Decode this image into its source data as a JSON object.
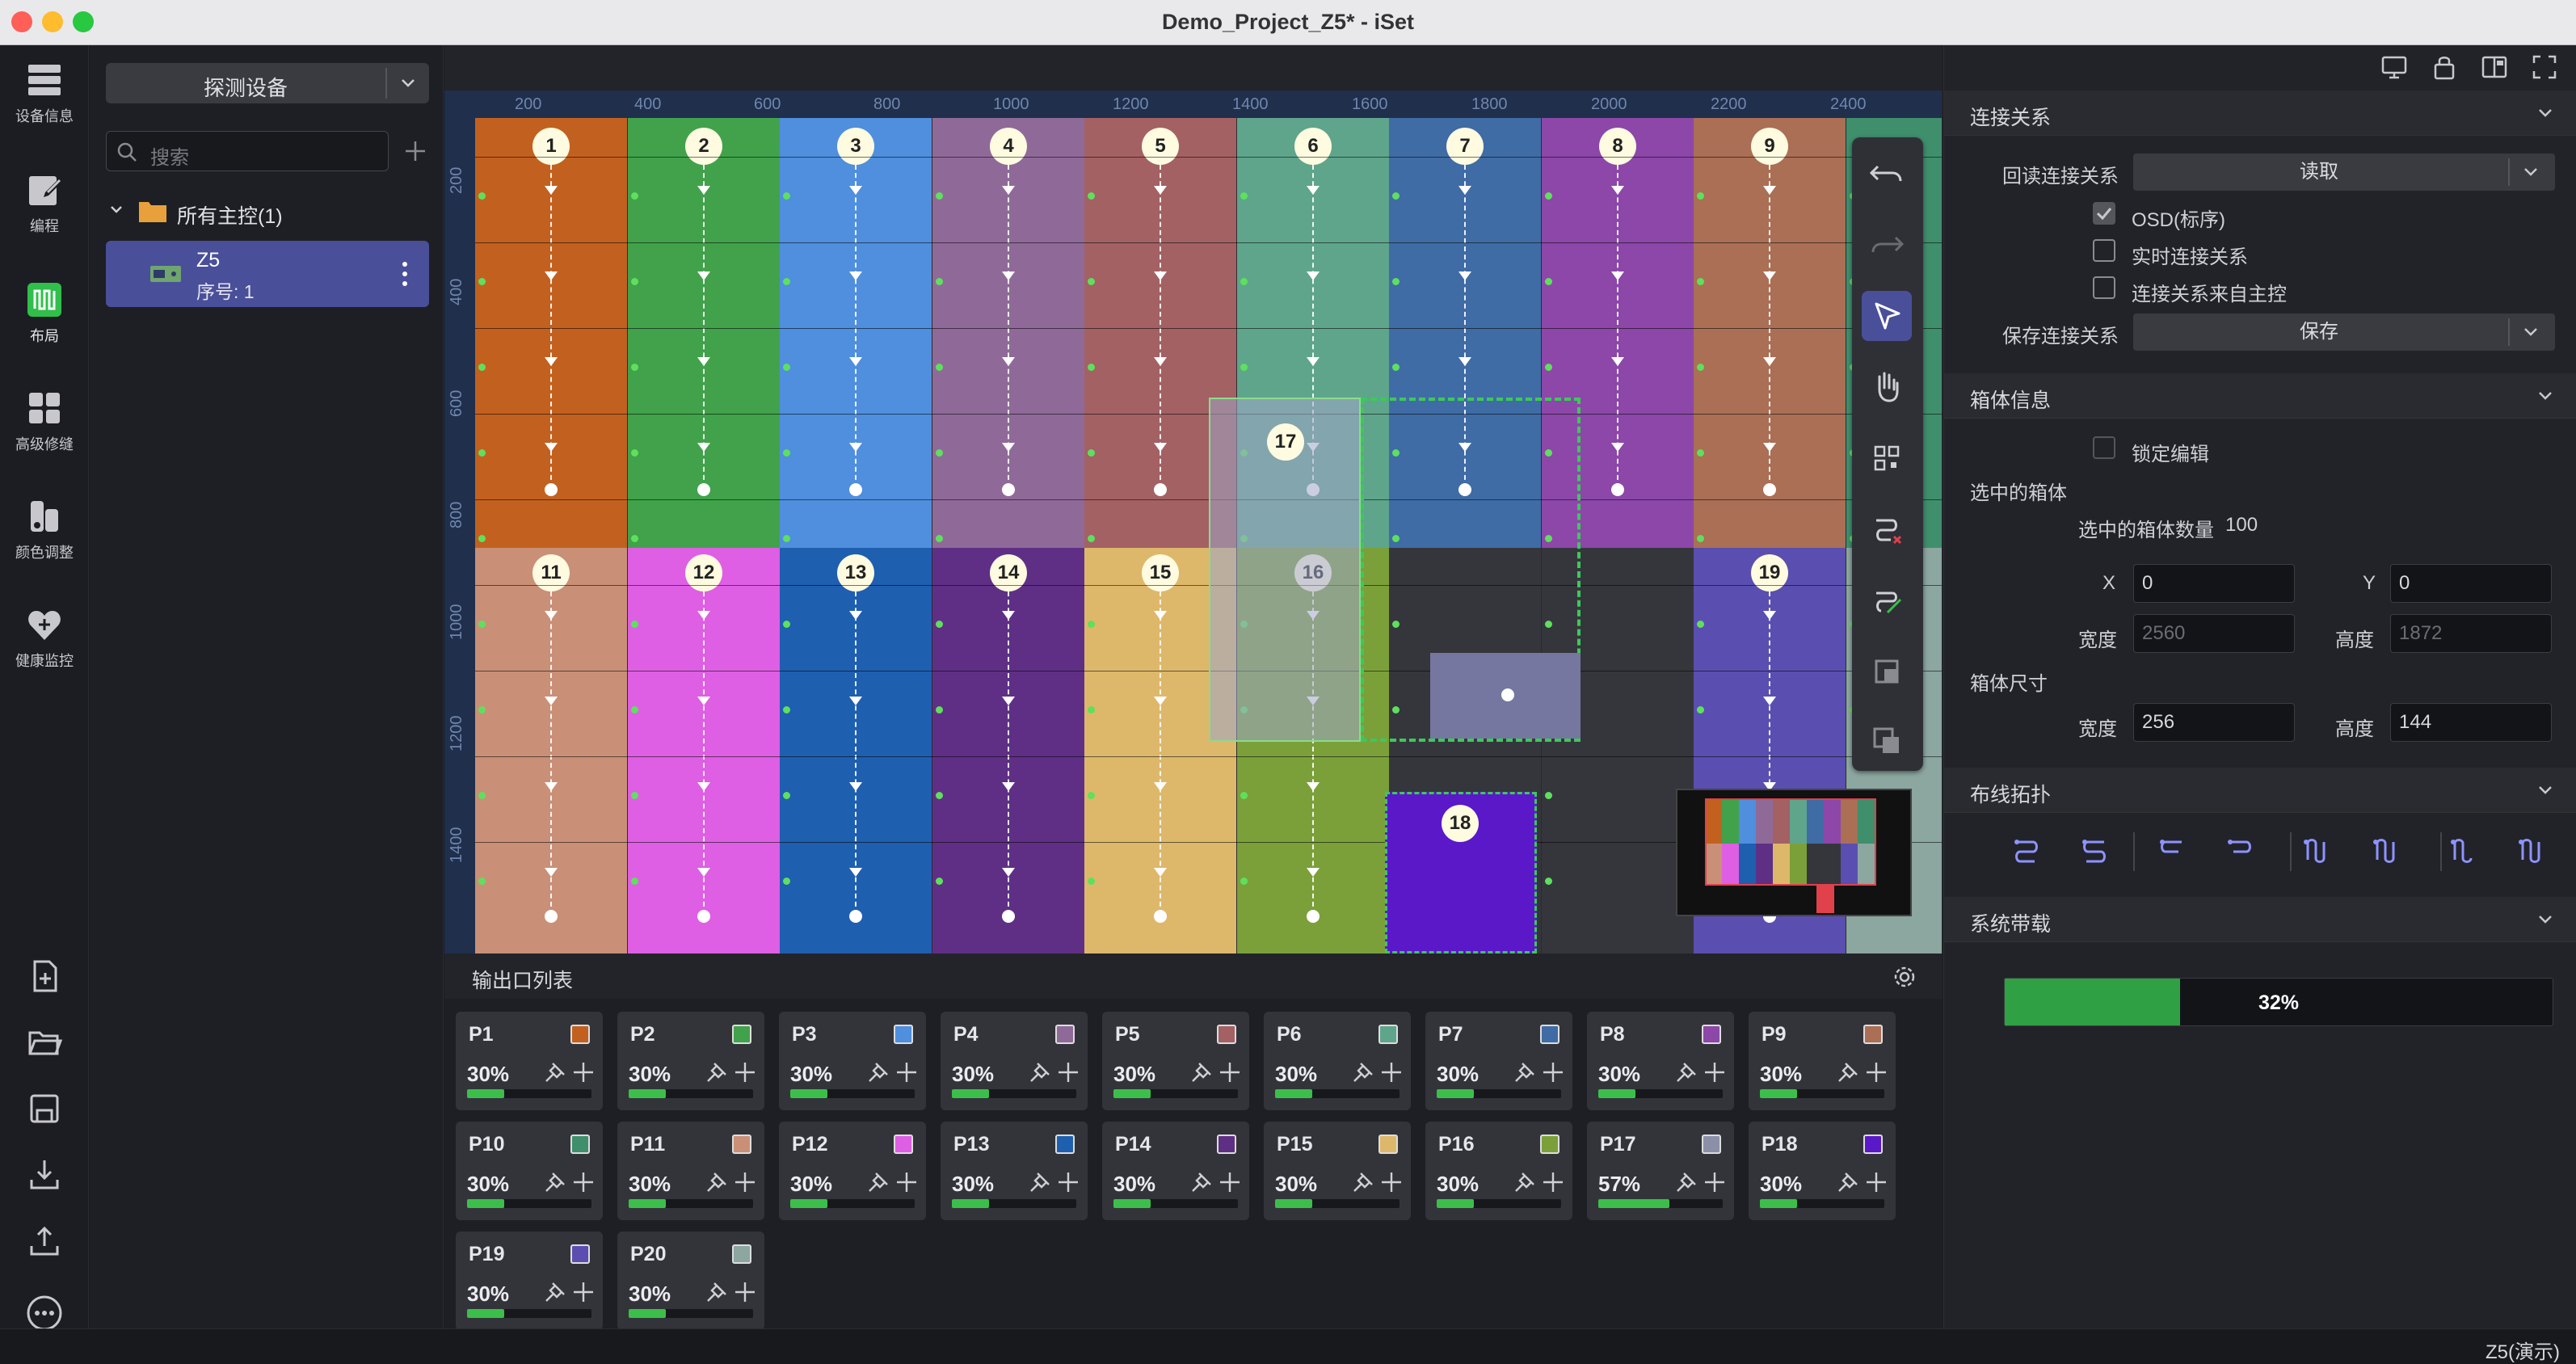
{
  "window": {
    "title": "Demo_Project_Z5* - iSet"
  },
  "nav": {
    "items": [
      {
        "label": "设备信息",
        "icon": "device-info-icon"
      },
      {
        "label": "编程",
        "icon": "edit-icon"
      },
      {
        "label": "布局",
        "icon": "layout-icon"
      },
      {
        "label": "高级修缝",
        "icon": "grid-icon"
      },
      {
        "label": "颜色调整",
        "icon": "color-adjust-icon"
      },
      {
        "label": "健康监控",
        "icon": "heart-icon"
      }
    ],
    "menu_label": "菜单"
  },
  "device_panel": {
    "probe_label": "探测设备",
    "search_placeholder": "搜索",
    "tree_root": "所有主控(1)",
    "device": {
      "name": "Z5",
      "serial": "序号: 1"
    }
  },
  "ruler": {
    "h_ticks": [
      "200",
      "400",
      "600",
      "800",
      "1000",
      "1200",
      "1400",
      "1600",
      "1800",
      "2000",
      "2200",
      "2400"
    ],
    "v_ticks": [
      "200",
      "400",
      "600",
      "800",
      "1000",
      "1200",
      "1400"
    ]
  },
  "layout": {
    "cols": [
      {
        "n": "1",
        "top": "#c2611f",
        "bot_n": "11",
        "bot": "#c99077"
      },
      {
        "n": "2",
        "top": "#41a24b",
        "bot_n": "12",
        "bot": "#de5fe3"
      },
      {
        "n": "3",
        "top": "#4f8fdd",
        "bot_n": "13",
        "bot": "#1f5fb0"
      },
      {
        "n": "4",
        "top": "#8f6a99",
        "bot_n": "14",
        "bot": "#5f2f86"
      },
      {
        "n": "5",
        "top": "#a36163",
        "bot_n": "15",
        "bot": "#deb86a"
      },
      {
        "n": "6",
        "top": "#5fa58c",
        "bot_n": "16",
        "bot": "#7ba03a"
      },
      {
        "n": "7",
        "top": "#3f6ca5",
        "bot_n": "",
        "bot": "#35363c"
      },
      {
        "n": "8",
        "top": "#8c47a9",
        "bot_n": "",
        "bot": "#35363c"
      },
      {
        "n": "9",
        "top": "#aa6f55",
        "bot_n": "19",
        "bot": "#5a4fb0"
      },
      {
        "n": "",
        "top": "#3f8f6c",
        "bot_n": "",
        "bot": "#8ca6a0"
      }
    ],
    "overlay_17": "17",
    "overlay_18": "18"
  },
  "output_list": {
    "title": "输出口列表",
    "ports": [
      {
        "name": "P1",
        "color": "#c2611f",
        "pct": "30%",
        "value": 0.3
      },
      {
        "name": "P2",
        "color": "#41a24b",
        "pct": "30%",
        "value": 0.3
      },
      {
        "name": "P3",
        "color": "#4f8fdd",
        "pct": "30%",
        "value": 0.3
      },
      {
        "name": "P4",
        "color": "#8f6a99",
        "pct": "30%",
        "value": 0.3
      },
      {
        "name": "P5",
        "color": "#a36163",
        "pct": "30%",
        "value": 0.3
      },
      {
        "name": "P6",
        "color": "#5fa58c",
        "pct": "30%",
        "value": 0.3
      },
      {
        "name": "P7",
        "color": "#3f6ca5",
        "pct": "30%",
        "value": 0.3
      },
      {
        "name": "P8",
        "color": "#8c47a9",
        "pct": "30%",
        "value": 0.3
      },
      {
        "name": "P9",
        "color": "#aa6f55",
        "pct": "30%",
        "value": 0.3
      },
      {
        "name": "P10",
        "color": "#3f8f6c",
        "pct": "30%",
        "value": 0.3
      },
      {
        "name": "P11",
        "color": "#c99077",
        "pct": "30%",
        "value": 0.3
      },
      {
        "name": "P12",
        "color": "#de5fe3",
        "pct": "30%",
        "value": 0.3
      },
      {
        "name": "P13",
        "color": "#1f5fb0",
        "pct": "30%",
        "value": 0.3
      },
      {
        "name": "P14",
        "color": "#5f2f86",
        "pct": "30%",
        "value": 0.3
      },
      {
        "name": "P15",
        "color": "#deb86a",
        "pct": "30%",
        "value": 0.3
      },
      {
        "name": "P16",
        "color": "#7ba03a",
        "pct": "30%",
        "value": 0.3
      },
      {
        "name": "P17",
        "color": "#8c8fa8",
        "pct": "57%",
        "value": 0.57
      },
      {
        "name": "P18",
        "color": "#5a18c9",
        "pct": "30%",
        "value": 0.3
      },
      {
        "name": "P19",
        "color": "#5a4fb0",
        "pct": "30%",
        "value": 0.3
      },
      {
        "name": "P20",
        "color": "#8ca6a0",
        "pct": "30%",
        "value": 0.3
      }
    ]
  },
  "right_panel": {
    "conn": {
      "title": "连接关系",
      "readback_label": "回读连接关系",
      "read_button": "读取",
      "osd_label": "OSD(标序)",
      "realtime_label": "实时连接关系",
      "from_master_label": "连接关系来自主控",
      "save_label": "保存连接关系",
      "save_button": "保存"
    },
    "cabinet": {
      "title": "箱体信息",
      "lock_label": "锁定编辑",
      "selected_title": "选中的箱体",
      "selected_count_label": "选中的箱体数量",
      "selected_count": "100",
      "x_label": "X",
      "x_value": "0",
      "y_label": "Y",
      "y_value": "0",
      "width_label": "宽度",
      "width_value": "2560",
      "height_label": "高度",
      "height_value": "1872",
      "size_title": "箱体尺寸",
      "size_width_label": "宽度",
      "size_width": "256",
      "size_height_label": "高度",
      "size_height": "144"
    },
    "topology": {
      "title": "布线拓扑"
    },
    "bandwidth": {
      "title": "系统带载",
      "value": "32%",
      "fraction": 0.32
    }
  },
  "status": {
    "text": "Z5(演示)"
  }
}
